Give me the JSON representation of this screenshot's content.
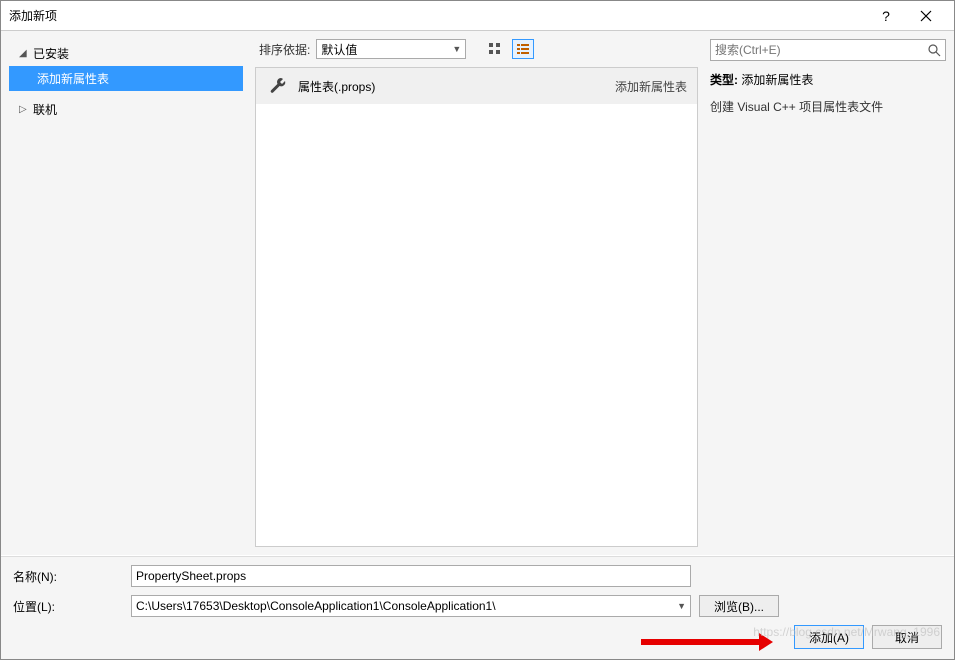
{
  "title": "添加新项",
  "sidebar": {
    "installed": "已安装",
    "items": [
      "添加新属性表"
    ],
    "online": "联机"
  },
  "toolbar": {
    "sort_label": "排序依据:",
    "sort_value": "默认值"
  },
  "items": [
    {
      "label": "属性表(.props)",
      "meta": "添加新属性表"
    }
  ],
  "search": {
    "placeholder": "搜索(Ctrl+E)"
  },
  "detail": {
    "type_label": "类型:",
    "type_value": "添加新属性表",
    "description": "创建 Visual C++ 项目属性表文件"
  },
  "form": {
    "name_label": "名称(N):",
    "name_value": "PropertySheet.props",
    "location_label": "位置(L):",
    "location_value": "C:\\Users\\17653\\Desktop\\ConsoleApplication1\\ConsoleApplication1\\",
    "browse": "浏览(B)..."
  },
  "actions": {
    "add": "添加(A)",
    "cancel": "取消"
  },
  "watermark": "https://blog.csdn.net/Mrwang_1996"
}
